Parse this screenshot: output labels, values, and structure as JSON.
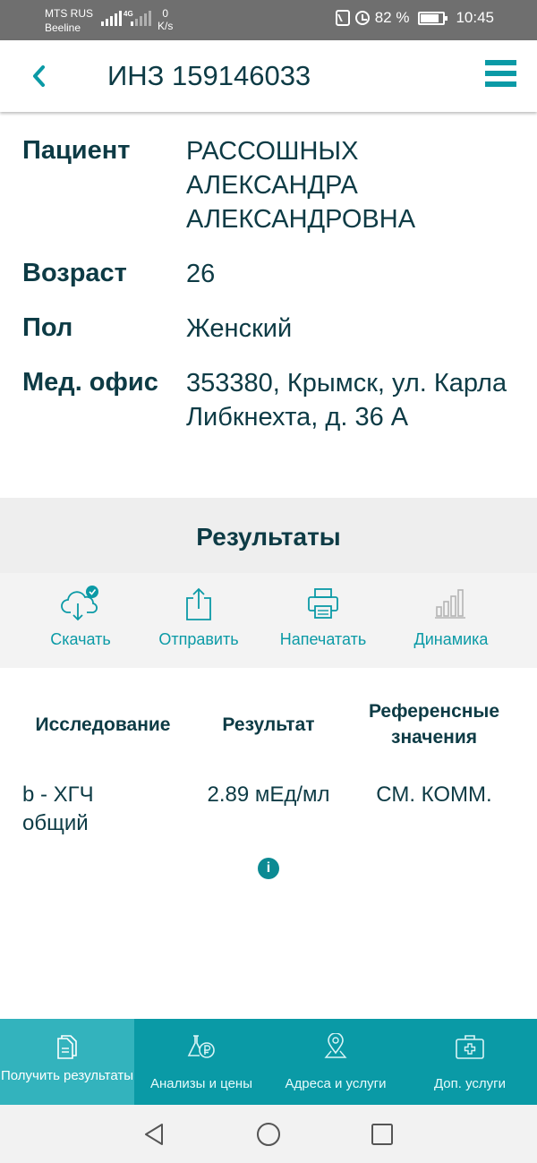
{
  "status_bar": {
    "carrier1": "MTS RUS",
    "carrier2": "Beeline",
    "net_type": "4G",
    "speed_value": "0",
    "speed_unit": "K/s",
    "battery": "82 %",
    "time": "10:45"
  },
  "header": {
    "back_icon": "chevron-left-icon",
    "title": "ИНЗ 159146033",
    "menu_icon": "hamburger-menu-icon"
  },
  "patient": {
    "rows": [
      {
        "label": "Пациент",
        "value": "РАССОШНЫХ АЛЕКСАНДРА АЛЕКСАНДРОВНА"
      },
      {
        "label": "Возраст",
        "value": "26"
      },
      {
        "label": "Пол",
        "value": "Женский"
      },
      {
        "label": "Мед. офис",
        "value": "353380, Крымск, ул. Карла Либкнехта, д. 36 А"
      }
    ]
  },
  "results": {
    "title": "Результаты",
    "actions": [
      {
        "label": "Скачать",
        "icon": "cloud-download-icon"
      },
      {
        "label": "Отправить",
        "icon": "share-icon"
      },
      {
        "label": "Напечатать",
        "icon": "printer-icon"
      },
      {
        "label": "Динамика",
        "icon": "bar-chart-icon"
      }
    ]
  },
  "table": {
    "headers": {
      "study": "Исследование",
      "result": "Результат",
      "reference": "Референсные значения"
    },
    "rows": [
      {
        "study": "b - ХГЧ общий",
        "result": "2.89 мЕд/мл",
        "reference": "СМ. КОММ."
      }
    ],
    "info_icon_label": "i"
  },
  "bottom_nav": {
    "items": [
      {
        "label": "Получить результаты",
        "icon": "document-icon",
        "active": true
      },
      {
        "label": "Анализы и цены",
        "icon": "flask-ruble-icon",
        "active": false
      },
      {
        "label": "Адреса и услуги",
        "icon": "map-pin-icon",
        "active": false
      },
      {
        "label": "Доп. услуги",
        "icon": "medical-kit-icon",
        "active": false
      }
    ]
  },
  "colors": {
    "accent": "#0b9aa6",
    "dark_text": "#0d3b45",
    "status_bar": "#6f6f6f",
    "nav_active": "#33b3bd"
  }
}
